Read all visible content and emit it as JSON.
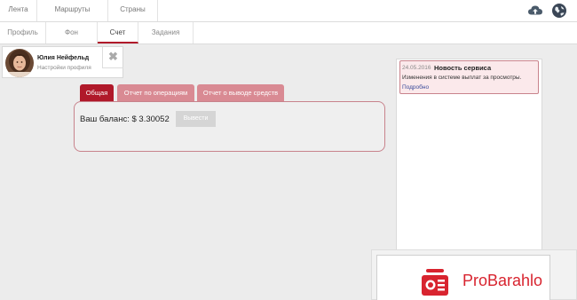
{
  "top_nav": {
    "tabs": [
      "Лента",
      "Маршруты",
      "Страны"
    ],
    "icons": [
      "cloud-upload-icon",
      "globe-icon"
    ]
  },
  "sub_nav": {
    "tabs": [
      "Профиль",
      "Фон",
      "Счет",
      "Задания"
    ],
    "active_tab": "Счет"
  },
  "profile": {
    "name": "Юлия Нейфельд",
    "subtitle": "Настройки профиля",
    "close_glyph": "✖"
  },
  "account": {
    "tabs": [
      "Общая",
      "Отчет по операциям",
      "Отчет о выводе средств"
    ],
    "active_tab": "Общая",
    "balance_label": "Ваш баланс: $ 3.30052",
    "withdraw_button": "Вывести"
  },
  "news": {
    "date": "24.05.2016",
    "title": "Новость сервиса",
    "text": "Изменения в системе выплат за просмотры.",
    "more_link": "Подробно"
  },
  "watermark": {
    "brand": "ProBarahlo"
  },
  "colors": {
    "accent": "#b0192a",
    "accent_light": "#d98a93",
    "panel_border": "#c8838c",
    "news_bg": "#fbe9eb",
    "brand_red": "#d8242f"
  }
}
